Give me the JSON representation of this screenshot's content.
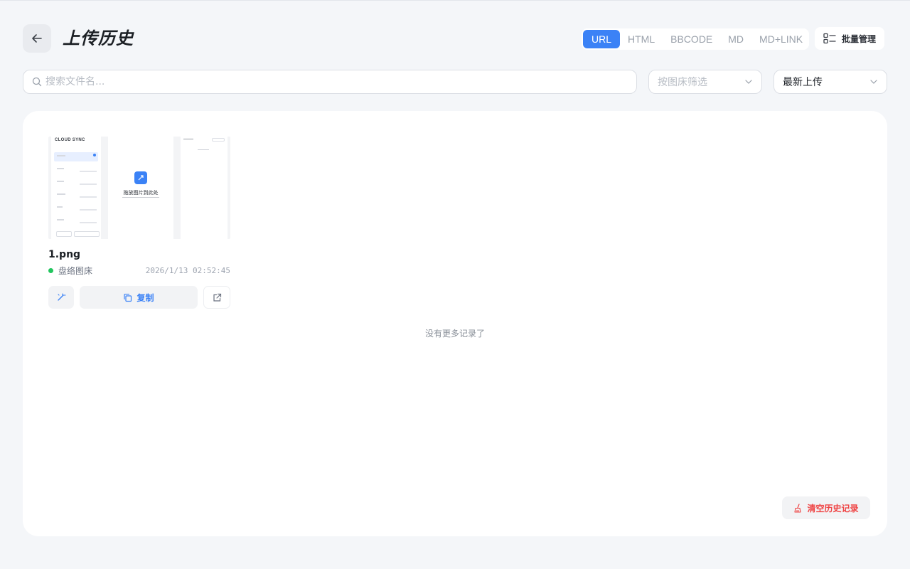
{
  "header": {
    "title": "上传历史",
    "format_tabs": [
      {
        "label": "URL",
        "active": true
      },
      {
        "label": "HTML",
        "active": false
      },
      {
        "label": "BBCODE",
        "active": false
      },
      {
        "label": "MD",
        "active": false
      },
      {
        "label": "MD+LINK",
        "active": false
      }
    ],
    "batch_label": "批量管理"
  },
  "filters": {
    "search_placeholder": "搜索文件名...",
    "host_placeholder": "按图床筛选",
    "sort_value": "最新上传"
  },
  "items": [
    {
      "file_name": "1.png",
      "host": "盘络图床",
      "status_color": "#22c55e",
      "time": "2026/1/13 02:52:45",
      "copy_label": "复制",
      "thumbnail": {
        "brand": "CLOUD SYNC",
        "center_text": "拖放图片到此处"
      }
    }
  ],
  "no_more_text": "没有更多记录了",
  "clear_label": "清空历史记录",
  "colors": {
    "accent": "#3b82f6",
    "danger": "#ef4444",
    "success": "#22c55e"
  }
}
